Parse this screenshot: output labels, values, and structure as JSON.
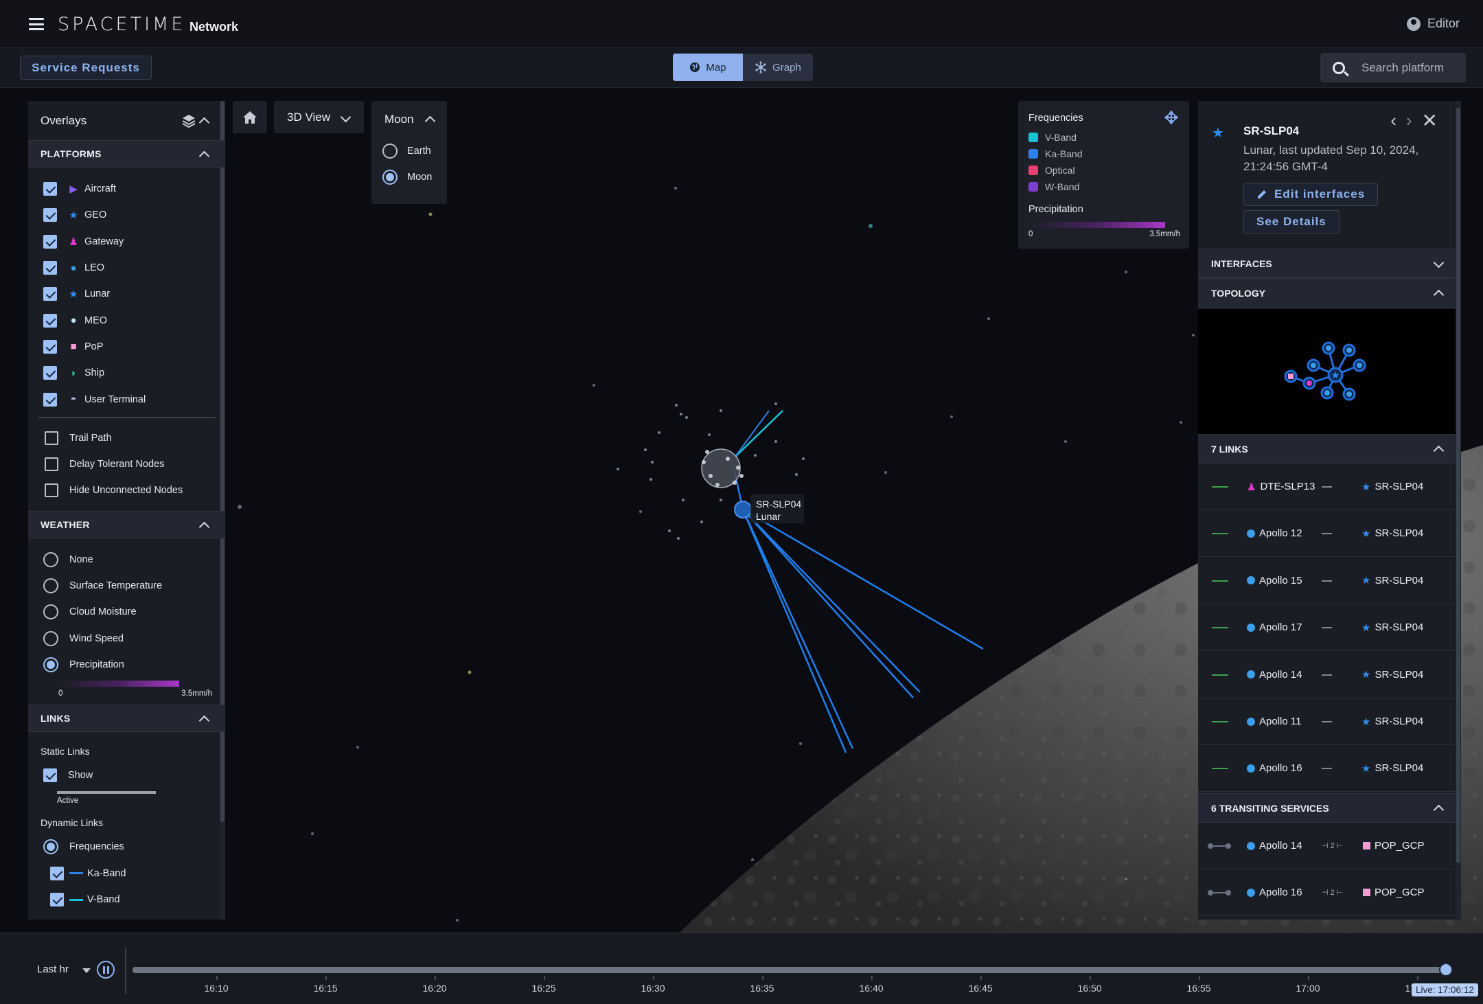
{
  "app": {
    "brand": "SPACETIME",
    "subtitle": "Network",
    "user": "Editor"
  },
  "subbar": {
    "service_requests": "Service Requests",
    "view_map": "Map",
    "view_graph": "Graph",
    "search_placeholder": "Search platform"
  },
  "overlays": {
    "title": "Overlays",
    "platforms_title": "PLATFORMS",
    "platforms": [
      {
        "label": "Aircraft",
        "checked": true,
        "icon": "triangle-icon",
        "color": "#8b5cf6"
      },
      {
        "label": "GEO",
        "checked": true,
        "icon": "star-icon",
        "color": "#2f8cf0"
      },
      {
        "label": "Gateway",
        "checked": true,
        "icon": "gateway-icon",
        "color": "#e238c9"
      },
      {
        "label": "LEO",
        "checked": true,
        "icon": "circle-icon",
        "color": "#3a9ee8"
      },
      {
        "label": "Lunar",
        "checked": true,
        "icon": "star-icon",
        "color": "#2f8cf0"
      },
      {
        "label": "MEO",
        "checked": true,
        "icon": "circle-icon",
        "color": "#bfe3f7"
      },
      {
        "label": "PoP",
        "checked": true,
        "icon": "square-icon",
        "color": "#f59bd5"
      },
      {
        "label": "Ship",
        "checked": true,
        "icon": "ship-icon",
        "color": "#1fd3a2"
      },
      {
        "label": "User Terminal",
        "checked": true,
        "icon": "dome-icon",
        "color": "#c7b8f0"
      }
    ],
    "options": [
      {
        "label": "Trail Path",
        "checked": false
      },
      {
        "label": "Delay Tolerant Nodes",
        "checked": false
      },
      {
        "label": "Hide Unconnected Nodes",
        "checked": false
      }
    ],
    "weather_title": "WEATHER",
    "weather": [
      {
        "label": "None",
        "selected": false
      },
      {
        "label": "Surface Temperature",
        "selected": false
      },
      {
        "label": "Cloud Moisture",
        "selected": false
      },
      {
        "label": "Wind Speed",
        "selected": false
      },
      {
        "label": "Precipitation",
        "selected": true
      }
    ],
    "precip_min": "0",
    "precip_max": "3.5mm/h",
    "links_title": "LINKS",
    "static_links": "Static Links",
    "show": "Show",
    "active": "Active",
    "dynamic_links": "Dynamic Links",
    "frequencies": "Frequencies",
    "bands": [
      {
        "label": "Ka-Band",
        "color": "#2f7fe6"
      },
      {
        "label": "V-Band",
        "color": "#19c3d6"
      }
    ]
  },
  "map_controls": {
    "view": "3D View",
    "body_title": "Moon",
    "bodies": [
      {
        "label": "Earth",
        "selected": false
      },
      {
        "label": "Moon",
        "selected": true
      }
    ],
    "node_label_name": "SR-SLP04",
    "node_label_type": "Lunar"
  },
  "legend": {
    "title": "Frequencies",
    "items": [
      {
        "label": "V-Band",
        "color": "#19c3d6"
      },
      {
        "label": "Ka-Band",
        "color": "#2f7fe6"
      },
      {
        "label": "Optical",
        "color": "#e8416f"
      },
      {
        "label": "W-Band",
        "color": "#7a3fd0"
      }
    ],
    "precip_title": "Precipitation",
    "precip_min": "0",
    "precip_max": "3.5mm/h"
  },
  "detail": {
    "title": "SR-SLP04",
    "subtitle": "Lunar, last updated Sep 10, 2024, 21:24:56 GMT-4",
    "edit_btn": "Edit interfaces",
    "details_btn": "See Details",
    "interfaces": "INTERFACES",
    "topology": "TOPOLOGY",
    "links_title": "7 LINKS",
    "links": [
      {
        "from": "DTE-SLP13",
        "from_icon": "gateway",
        "to": "SR-SLP04",
        "sep": "—"
      },
      {
        "from": "Apollo 12",
        "from_icon": "dot",
        "to": "SR-SLP04",
        "sep": "—"
      },
      {
        "from": "Apollo 15",
        "from_icon": "dot",
        "to": "SR-SLP04",
        "sep": "—"
      },
      {
        "from": "Apollo 17",
        "from_icon": "dot",
        "to": "SR-SLP04",
        "sep": "—"
      },
      {
        "from": "Apollo 14",
        "from_icon": "dot",
        "to": "SR-SLP04",
        "sep": "—"
      },
      {
        "from": "Apollo 11",
        "from_icon": "dot",
        "to": "SR-SLP04",
        "sep": "—"
      },
      {
        "from": "Apollo 16",
        "from_icon": "dot",
        "to": "SR-SLP04",
        "sep": "—"
      }
    ],
    "services_title": "6 TRANSITING SERVICES",
    "services": [
      {
        "from": "Apollo 14",
        "hops": "⊣ 2 ⊢",
        "to": "POP_GCP"
      },
      {
        "from": "Apollo 16",
        "hops": "⊣ 2 ⊢",
        "to": "POP_GCP"
      }
    ]
  },
  "timeline": {
    "range": "Last hr",
    "ticks": [
      "16:10",
      "16:15",
      "16:20",
      "16:25",
      "16:30",
      "16:35",
      "16:40",
      "16:45",
      "16:50",
      "16:55",
      "17:00",
      "17:05"
    ],
    "live": "Live: 17:06:12",
    "position": 1.0
  }
}
